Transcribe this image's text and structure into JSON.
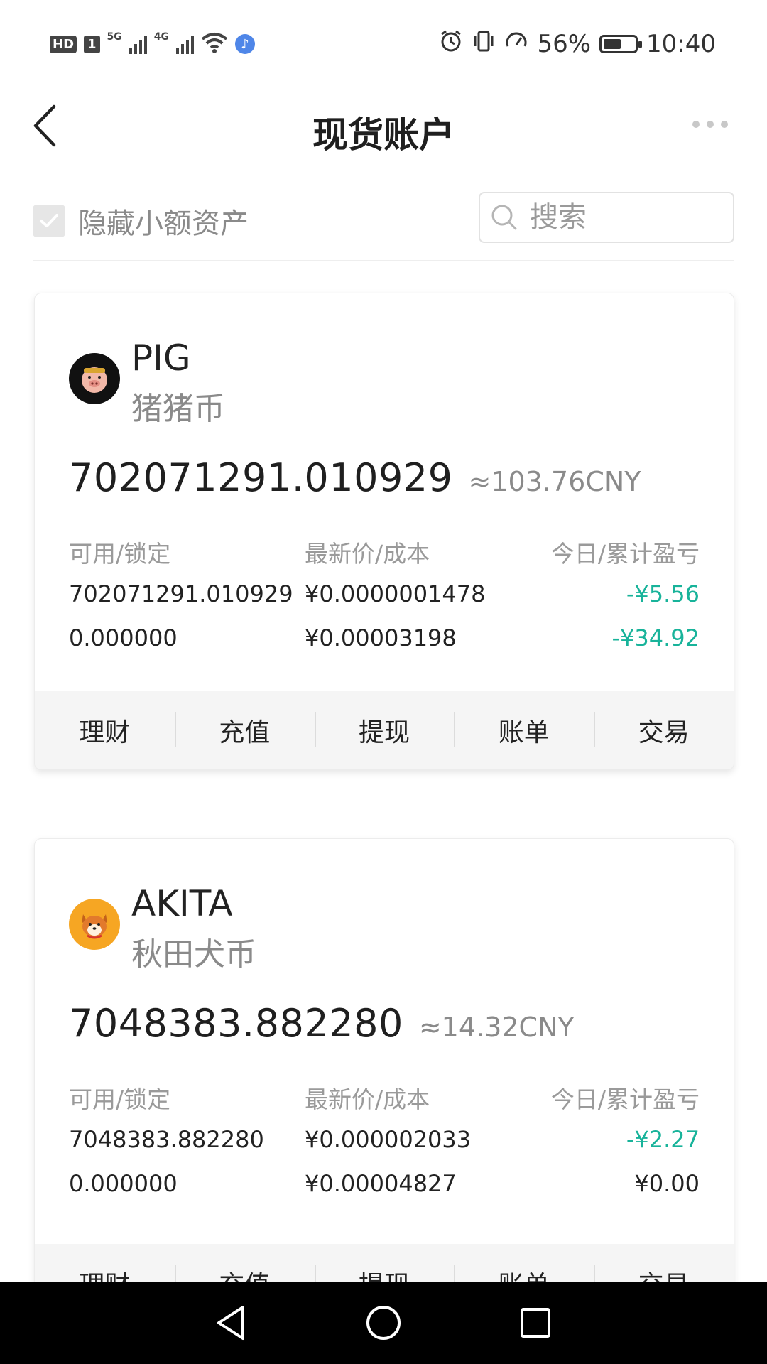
{
  "status_bar": {
    "hd": "HD",
    "sim": "1",
    "net1": "5G",
    "net2": "4G",
    "battery_percent": "56%",
    "battery_level": 0.56,
    "time": "10:40"
  },
  "header": {
    "title": "现货账户"
  },
  "filter": {
    "hide_small_label": "隐藏小额资产",
    "hide_small_checked": true,
    "search_placeholder": "搜索"
  },
  "assets": [
    {
      "symbol": "PIG",
      "name": "猪猪币",
      "amount": "702071291.010929",
      "approx": "≈103.76CNY",
      "col_headers": [
        "可用/锁定",
        "最新价/成本",
        "今日/累计盈亏"
      ],
      "available": "702071291.010929",
      "locked": "0.000000",
      "latest_price": "¥0.0000001478",
      "cost": "¥0.00003198",
      "today_pnl": "-¥5.56",
      "total_pnl": "-¥34.92",
      "actions": [
        "理财",
        "充值",
        "提现",
        "账单",
        "交易"
      ]
    },
    {
      "symbol": "AKITA",
      "name": "秋田犬币",
      "amount": "7048383.882280",
      "approx": "≈14.32CNY",
      "col_headers": [
        "可用/锁定",
        "最新价/成本",
        "今日/累计盈亏"
      ],
      "available": "7048383.882280",
      "locked": "0.000000",
      "latest_price": "¥0.000002033",
      "cost": "¥0.00004827",
      "today_pnl": "-¥2.27",
      "total_pnl": "¥0.00",
      "actions": [
        "理财",
        "充值",
        "提现",
        "账单",
        "交易"
      ]
    }
  ],
  "colors": {
    "negative": "#18b39a",
    "muted": "#8a8a8a",
    "action_bg": "#f5f5f5"
  },
  "icons": {
    "back": "chevron-left-icon",
    "more": "more-dots-icon",
    "search": "search-icon",
    "check": "check-icon",
    "nav_back": "triangle-back-icon",
    "nav_home": "circle-home-icon",
    "nav_recent": "square-recents-icon"
  }
}
